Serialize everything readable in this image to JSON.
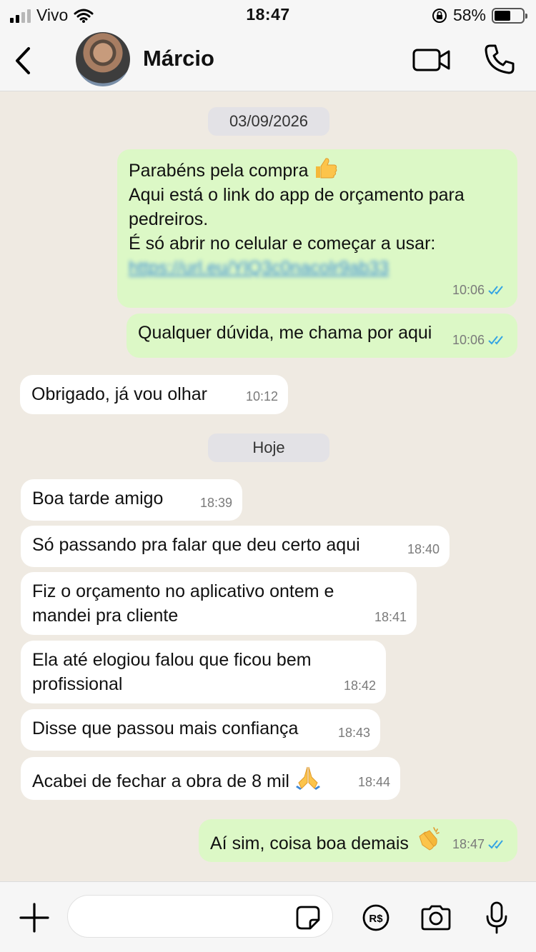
{
  "status_bar": {
    "carrier": "Vivo",
    "time": "18:47",
    "battery": "58%"
  },
  "header": {
    "contact_name": "Márcio"
  },
  "dates": {
    "first": "03/09/2026",
    "today": "Hoje"
  },
  "messages": [
    {
      "dir": "out",
      "lines": [
        "Parabéns pela compra",
        "Aqui está o link do app de orçamento para",
        "pedreiros.",
        "É só abrir no celular e começar a usar:"
      ],
      "link": "https://url.eu/YlQ3c0nacolr9ab33",
      "time": "10:06",
      "emoji": "thumbs-up"
    },
    {
      "dir": "out",
      "text": "Qualquer dúvida, me chama por aqui",
      "time": "10:06"
    },
    {
      "dir": "in",
      "text": "Obrigado, já vou olhar",
      "time": "10:12"
    },
    {
      "dir": "in",
      "text": "Boa tarde amigo",
      "time": "18:39"
    },
    {
      "dir": "in",
      "text": "Só passando pra falar que deu certo aqui",
      "time": "18:40"
    },
    {
      "dir": "in",
      "lines": [
        "Fiz o orçamento no aplicativo ontem e",
        "mandei pra cliente"
      ],
      "time": "18:41"
    },
    {
      "dir": "in",
      "lines": [
        "Ela até elogiou falou que ficou bem",
        "profissional"
      ],
      "time": "18:42"
    },
    {
      "dir": "in",
      "text": "Disse que passou mais confiança",
      "time": "18:43"
    },
    {
      "dir": "in",
      "text": "Acabei de fechar a obra de 8 mil",
      "time": "18:44",
      "emoji": "folded-hands"
    },
    {
      "dir": "out",
      "text": "Aí sim, coisa boa demais",
      "time": "18:47",
      "emoji": "clapping-hands"
    }
  ],
  "colors": {
    "outgoing": "#dcf8c6",
    "incoming": "#ffffff",
    "tick_read": "#34a3e3",
    "background": "#efeae2"
  }
}
